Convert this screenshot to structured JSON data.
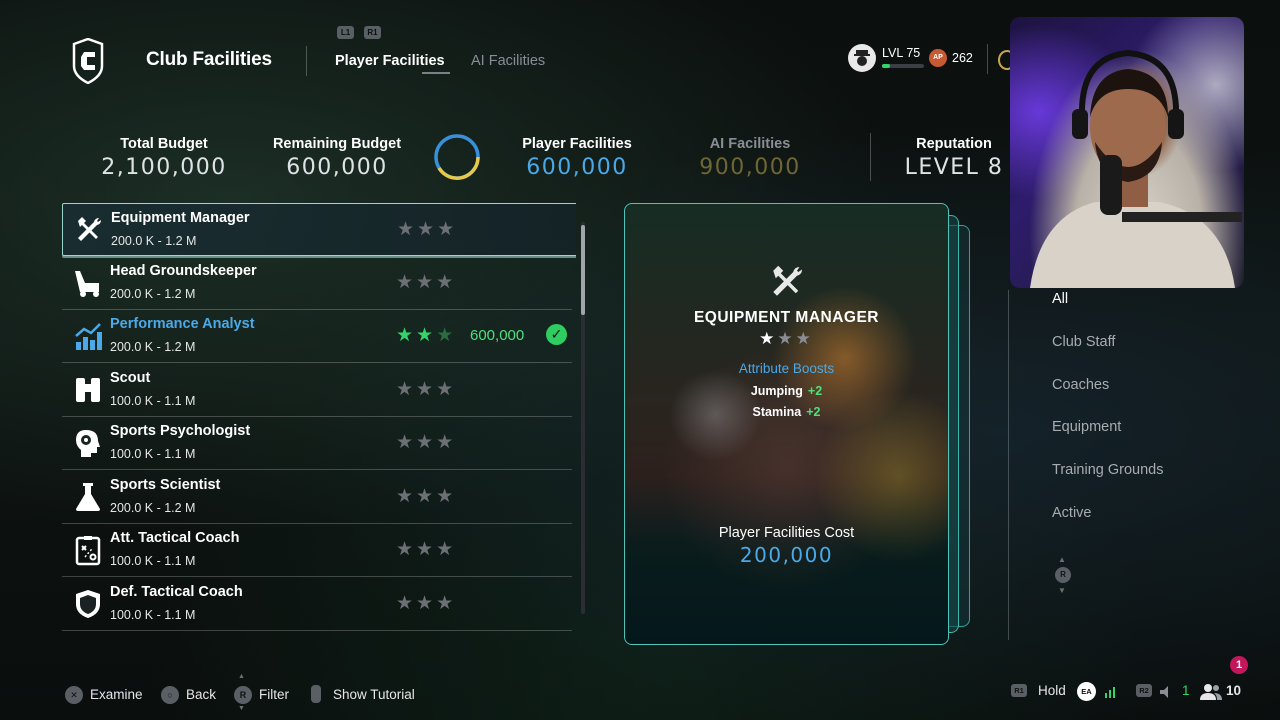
{
  "header": {
    "title": "Club Facilities",
    "tab_hints": [
      "L1",
      "R1"
    ],
    "tabs": [
      {
        "label": "Player Facilities",
        "active": true
      },
      {
        "label": "AI Facilities",
        "active": false
      }
    ],
    "level": "LVL 75",
    "ap_icon": "AP",
    "ap_value": "262"
  },
  "budget": {
    "total_label": "Total Budget",
    "total_value": "2,100,000",
    "remaining_label": "Remaining Budget",
    "remaining_value": "600,000",
    "player_label": "Player Facilities",
    "player_value": "600,000",
    "ai_label": "AI Facilities",
    "ai_value": "900,000",
    "reputation_label": "Reputation",
    "reputation_value": "LEVEL 8",
    "colors": {
      "player": "#4aa9e6",
      "ai": "#8a7d3a",
      "ring_blue": "#3a8fd9",
      "ring_yellow": "#e6c84a"
    }
  },
  "facilities": [
    {
      "name": "Equipment Manager",
      "range": "200.0 K - 1.2 M",
      "icon": "tools-icon",
      "stars": 0,
      "cost": "",
      "owned": false,
      "selected": true
    },
    {
      "name": "Head Groundskeeper",
      "range": "200.0 K - 1.2 M",
      "icon": "lawnmower-icon",
      "stars": 0,
      "cost": "",
      "owned": false,
      "selected": false
    },
    {
      "name": "Performance Analyst",
      "range": "200.0 K - 1.2 M",
      "icon": "chart-icon",
      "stars": 2,
      "cost": "600,000",
      "owned": true,
      "selected": false
    },
    {
      "name": "Scout",
      "range": "100.0 K - 1.1 M",
      "icon": "binoculars-icon",
      "stars": 0,
      "cost": "",
      "owned": false,
      "selected": false
    },
    {
      "name": "Sports Psychologist",
      "range": "100.0 K - 1.1 M",
      "icon": "brain-head-icon",
      "stars": 0,
      "cost": "",
      "owned": false,
      "selected": false
    },
    {
      "name": "Sports Scientist",
      "range": "200.0 K - 1.2 M",
      "icon": "flask-icon",
      "stars": 0,
      "cost": "",
      "owned": false,
      "selected": false
    },
    {
      "name": "Att. Tactical Coach",
      "range": "100.0 K - 1.1 M",
      "icon": "tactics-board-icon",
      "stars": 0,
      "cost": "",
      "owned": false,
      "selected": false
    },
    {
      "name": "Def. Tactical Coach",
      "range": "100.0 K - 1.1 M",
      "icon": "shield-icon",
      "stars": 0,
      "cost": "",
      "owned": false,
      "selected": false
    }
  ],
  "detail_card": {
    "icon": "tools-icon",
    "title": "EQUIPMENT MANAGER",
    "stars": 1,
    "boost_heading": "Attribute Boosts",
    "boosts": [
      {
        "attr": "Jumping",
        "value": "+2"
      },
      {
        "attr": "Stamina",
        "value": "+2"
      }
    ],
    "cost_label": "Player Facilities Cost",
    "cost_value": "200,000"
  },
  "filters": [
    {
      "label": "All",
      "active": true
    },
    {
      "label": "Club Staff",
      "active": false
    },
    {
      "label": "Coaches",
      "active": false
    },
    {
      "label": "Equipment",
      "active": false
    },
    {
      "label": "Training Grounds",
      "active": false
    },
    {
      "label": "Active",
      "active": false
    }
  ],
  "filter_scroll_hint": "R",
  "footer": {
    "hints": [
      {
        "button": "✕",
        "label": "Examine"
      },
      {
        "button": "○",
        "label": "Back"
      },
      {
        "button": "R",
        "label": "Filter"
      },
      {
        "button": "",
        "label": "Show Tutorial"
      }
    ],
    "right": {
      "r1": "R1",
      "hold": "Hold",
      "ea": "EA",
      "r2": "R2",
      "count_green": "1",
      "friends": "10",
      "notifications": "1"
    }
  }
}
